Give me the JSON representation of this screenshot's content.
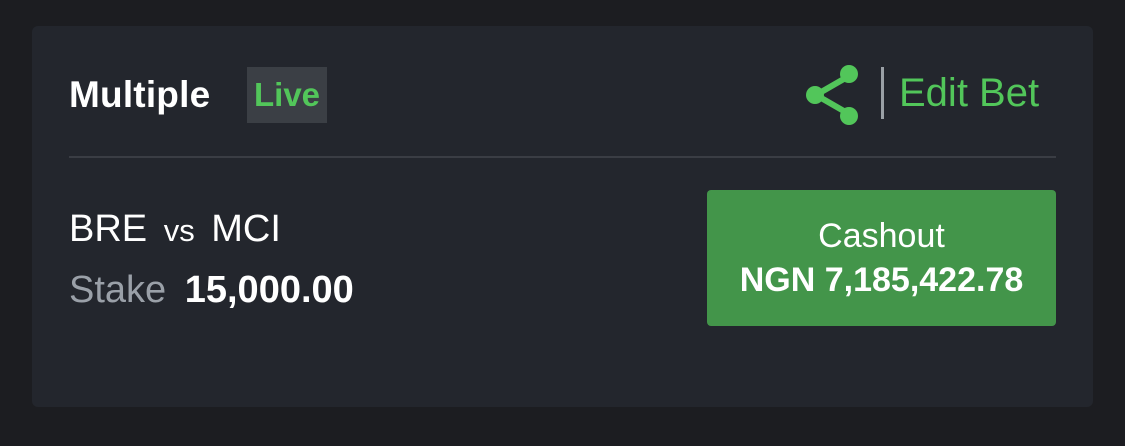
{
  "bet": {
    "title": "Multiple",
    "live_badge": "Live",
    "edit_label": "Edit Bet",
    "match": {
      "home": "BRE",
      "vs": "vs",
      "away": "MCI"
    },
    "stake_label": "Stake",
    "stake_value": "15,000.00",
    "cashout": {
      "label": "Cashout",
      "amount": "NGN 7,185,422.78"
    }
  },
  "icons": {
    "share": "share-icon"
  },
  "colors": {
    "accent_green": "#52c65a",
    "cashout_green": "#43954a",
    "card_bg": "#23262d",
    "page_bg": "#1c1d21"
  }
}
